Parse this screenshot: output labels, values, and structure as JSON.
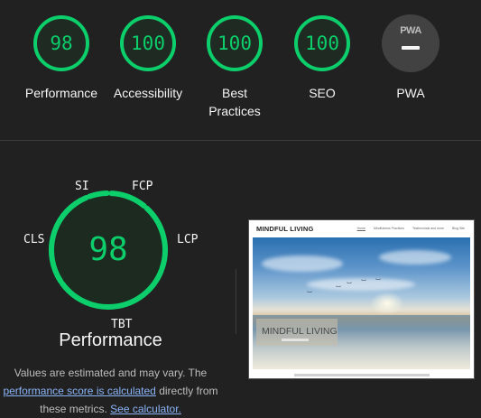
{
  "colors": {
    "pass": "#0cce6b",
    "pass_track": "#1f3a28",
    "background": "#212121",
    "link": "#8ab4f8"
  },
  "categories": [
    {
      "score": "98",
      "label": "Performance",
      "fraction": 0.98
    },
    {
      "score": "100",
      "label": "Accessibility",
      "fraction": 1.0
    },
    {
      "score": "100",
      "label_line1": "Best",
      "label_line2": "Practices",
      "fraction": 1.0
    },
    {
      "score": "100",
      "label": "SEO",
      "fraction": 1.0
    }
  ],
  "pwa": {
    "badge_text": "PWA",
    "label": "PWA",
    "icon": "pwa-dash-icon"
  },
  "performance": {
    "score": "98",
    "title": "Performance",
    "metrics": [
      "SI",
      "FCP",
      "LCP",
      "TBT",
      "CLS"
    ],
    "note_before": "Values are estimated and may vary. The",
    "link_score": "performance score is calculated",
    "note_middle": "directly from",
    "note_after": "these metrics.",
    "link_calc": "See calculator."
  },
  "screenshot": {
    "brand": "MINDFUL LIVING",
    "nav": [
      "Home",
      "Mindfulness Practices",
      "Testimonials and more",
      "Blog Site"
    ],
    "hero_text": "MINDFUL LIVING"
  }
}
